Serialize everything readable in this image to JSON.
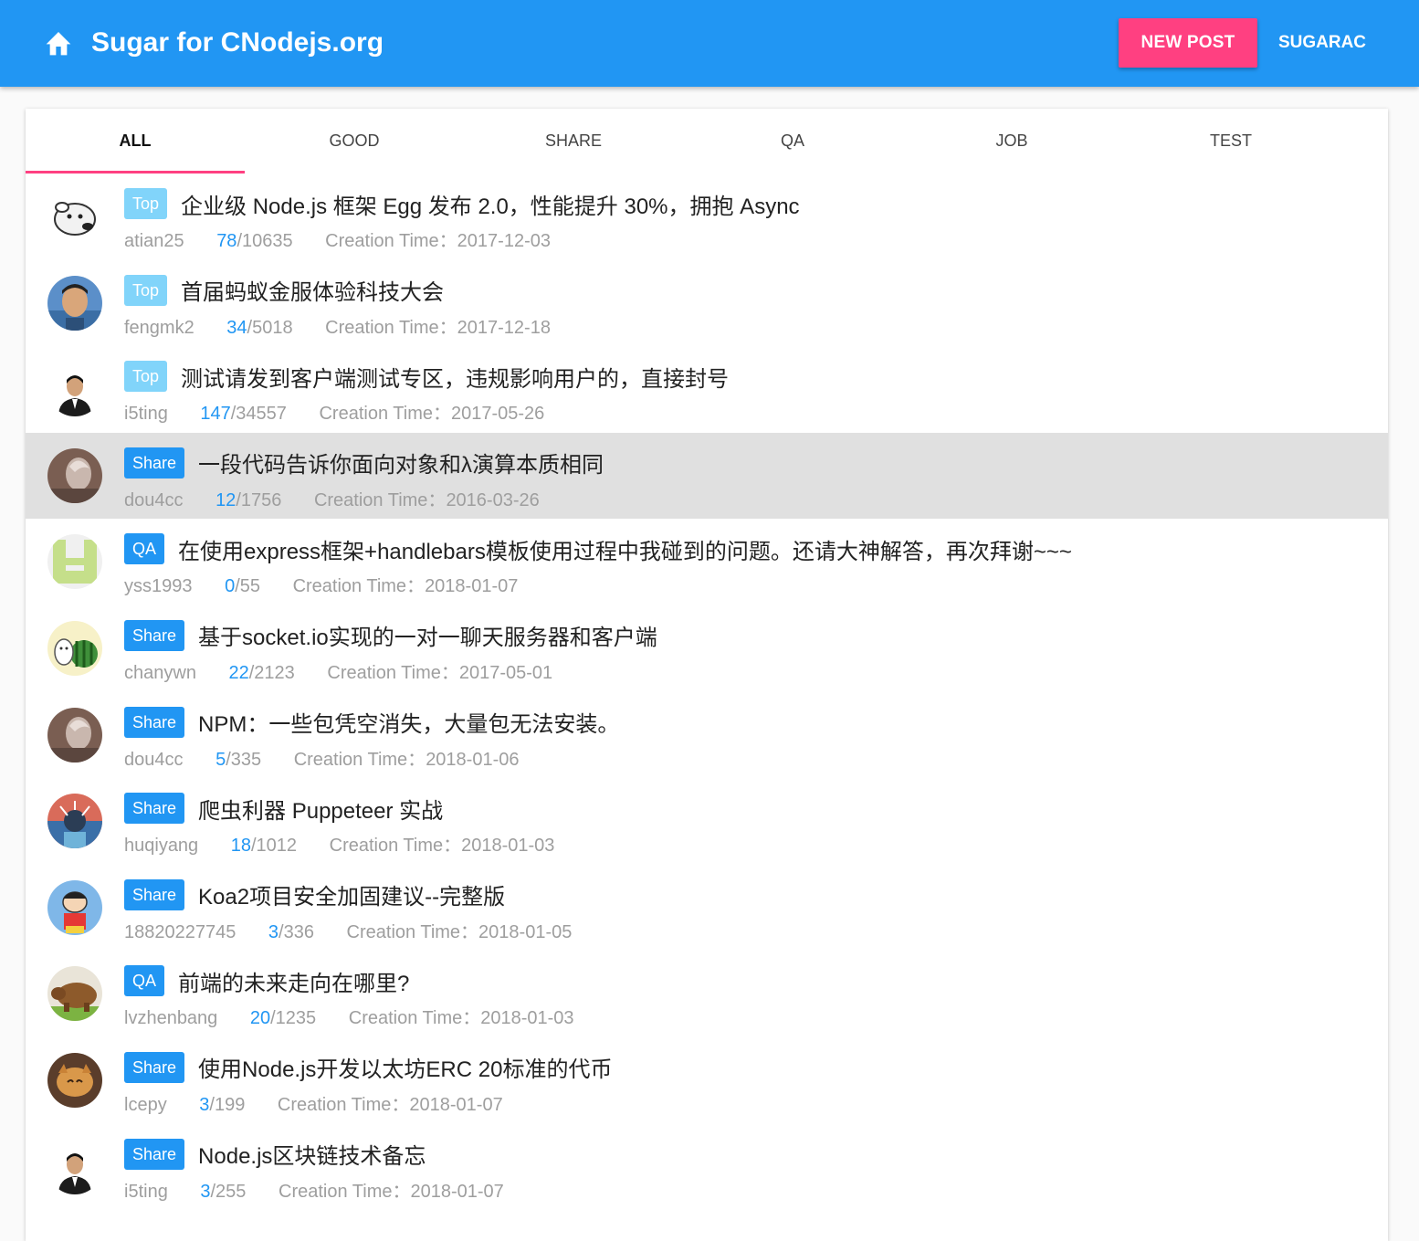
{
  "header": {
    "title": "Sugar for CNodejs.org",
    "new_post_label": "NEW POST",
    "user_label": "SUGARAC",
    "bar_color": "#2196f3",
    "accent_color": "#ff4081"
  },
  "tabs": [
    {
      "label": "ALL",
      "active": true
    },
    {
      "label": "GOOD",
      "active": false
    },
    {
      "label": "SHARE",
      "active": false
    },
    {
      "label": "QA",
      "active": false
    },
    {
      "label": "JOB",
      "active": false
    },
    {
      "label": "TEST",
      "active": false
    }
  ],
  "creation_label": "Creation Time：",
  "topics": [
    {
      "tag": "Top",
      "title": "企业级 Node.js 框架 Egg 发布 2.0，性能提升 30%，拥抱 Async",
      "author": "atian25",
      "replies": "78",
      "views": "/10635",
      "date": "2017-12-03"
    },
    {
      "tag": "Top",
      "title": "首届蚂蚁金服体验科技大会",
      "author": "fengmk2",
      "replies": "34",
      "views": "/5018",
      "date": "2017-12-18"
    },
    {
      "tag": "Top",
      "title": "测试请发到客户端测试专区，违规影响用户的，直接封号",
      "author": "i5ting",
      "replies": "147",
      "views": "/34557",
      "date": "2017-05-26"
    },
    {
      "tag": "Share",
      "title": "一段代码告诉你面向对象和λ演算本质相同",
      "author": "dou4cc",
      "replies": "12",
      "views": "/1756",
      "date": "2016-03-26"
    },
    {
      "tag": "QA",
      "title": "在使用express框架+handlebars模板使用过程中我碰到的问题。还请大神解答，再次拜谢~~~",
      "author": "yss1993",
      "replies": "0",
      "views": "/55",
      "date": "2018-01-07"
    },
    {
      "tag": "Share",
      "title": "基于socket.io实现的一对一聊天服务器和客户端",
      "author": "chanywn",
      "replies": "22",
      "views": "/2123",
      "date": "2017-05-01"
    },
    {
      "tag": "Share",
      "title": "NPM：一些包凭空消失，大量包无法安装。",
      "author": "dou4cc",
      "replies": "5",
      "views": "/335",
      "date": "2018-01-06"
    },
    {
      "tag": "Share",
      "title": "爬虫利器 Puppeteer 实战",
      "author": "huqiyang",
      "replies": "18",
      "views": "/1012",
      "date": "2018-01-03"
    },
    {
      "tag": "Share",
      "title": "Koa2项目安全加固建议--完整版",
      "author": "18820227745",
      "replies": "3",
      "views": "/336",
      "date": "2018-01-05"
    },
    {
      "tag": "QA",
      "title": "前端的未来走向在哪里?",
      "author": "lvzhenbang",
      "replies": "20",
      "views": "/1235",
      "date": "2018-01-03"
    },
    {
      "tag": "Share",
      "title": "使用Node.js开发以太坊ERC 20标准的代币",
      "author": "lcepy",
      "replies": "3",
      "views": "/199",
      "date": "2018-01-07"
    },
    {
      "tag": "Share",
      "title": "Node.js区块链技术备忘",
      "author": "i5ting",
      "replies": "3",
      "views": "/255",
      "date": "2018-01-07"
    }
  ]
}
